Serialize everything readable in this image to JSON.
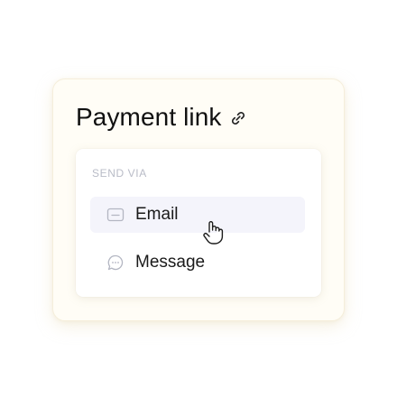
{
  "card": {
    "title": "Payment link",
    "title_icon": "link-icon"
  },
  "send_via": {
    "label": "SEND VIA",
    "options": [
      {
        "label": "Email",
        "icon": "mail-icon",
        "highlighted": true
      },
      {
        "label": "Message",
        "icon": "chat-bubble-icon",
        "highlighted": false
      }
    ]
  },
  "pointer": {
    "icon": "hand-pointer-icon"
  },
  "colors": {
    "card_background": "#fffdf6",
    "card_border": "#f5eedb",
    "panel_background": "#ffffff",
    "highlight_background": "#f4f4fb",
    "section_label": "#b9bcc7",
    "text": "#111111"
  }
}
